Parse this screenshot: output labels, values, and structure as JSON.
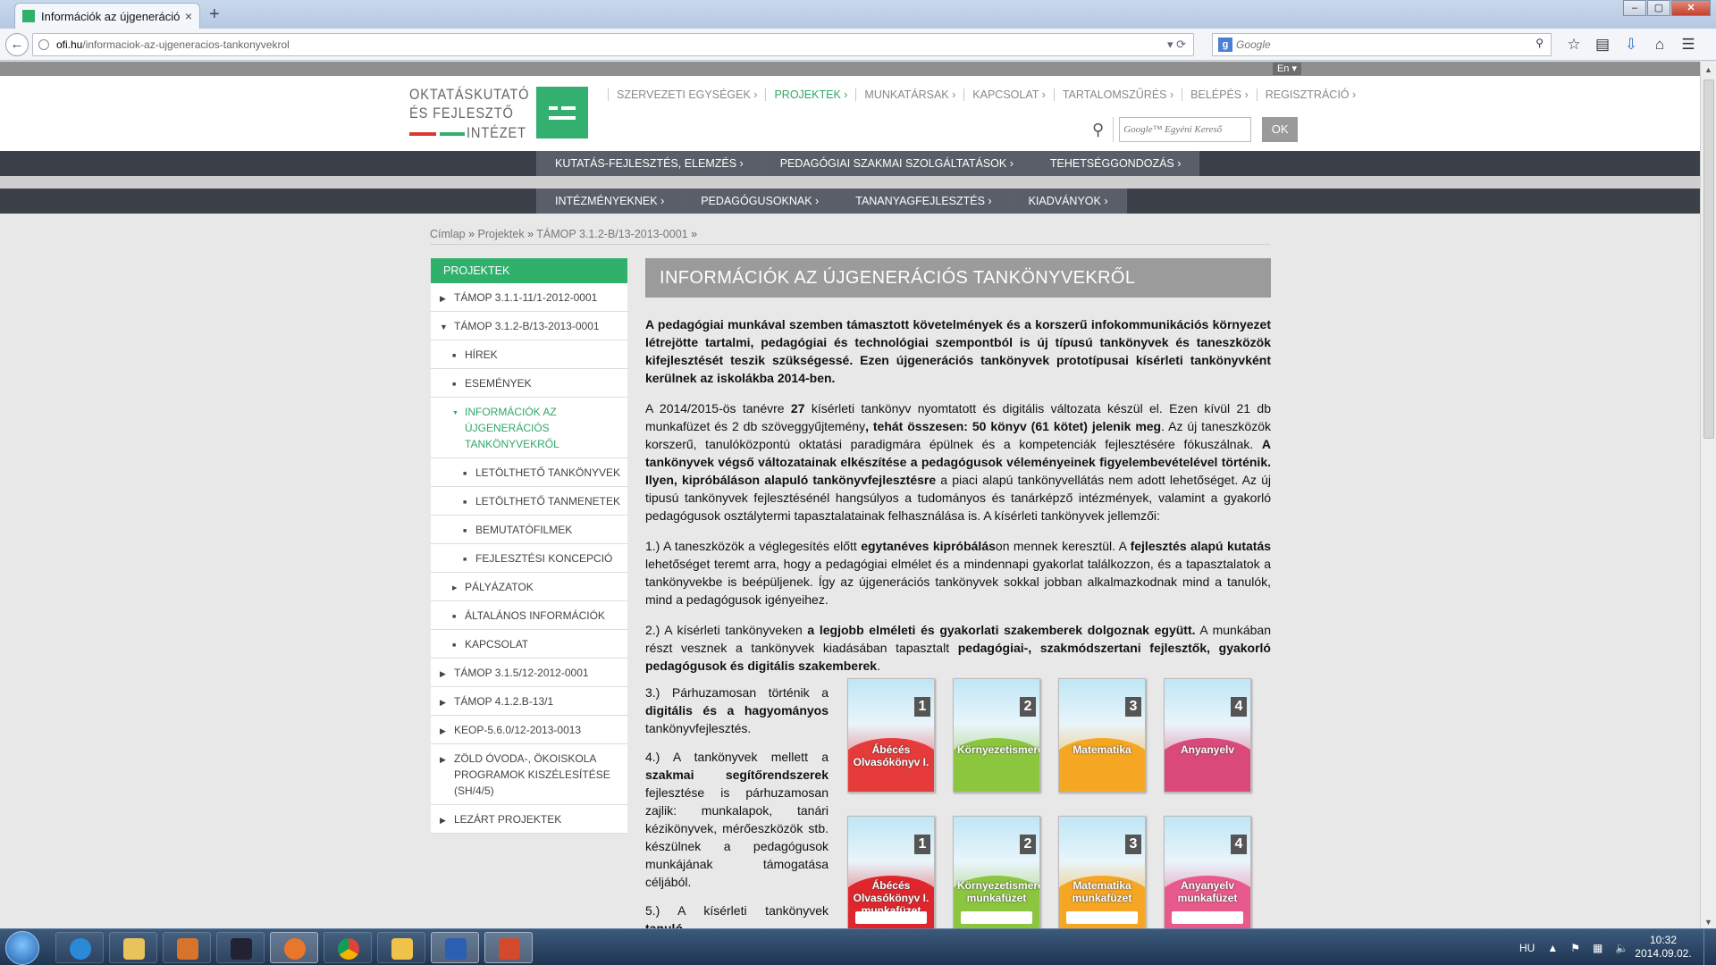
{
  "browser": {
    "tab_title": "Információk az újgeneráció...",
    "tab_close": "×",
    "new_tab": "+",
    "url_host": "ofi.hu",
    "url_path": "/informaciok-az-ujgeneracios-tankonyvekrol",
    "search_placeholder": "Google",
    "window_controls": [
      "–",
      "▢",
      "✕"
    ]
  },
  "site": {
    "lang": "En ▾",
    "logo": {
      "line1": "OKTATÁSKUTATÓ",
      "line2": "ÉS FEJLESZTŐ",
      "line3": "INTÉZET"
    },
    "top_menu": [
      {
        "label": "SZERVEZETI EGYSÉGEK ›",
        "active": false
      },
      {
        "label": "PROJEKTEK ›",
        "active": true
      },
      {
        "label": "MUNKATÁRSAK ›",
        "active": false
      },
      {
        "label": "KAPCSOLAT ›",
        "active": false
      },
      {
        "label": "TARTALOMSZŰRÉS ›",
        "active": false
      },
      {
        "label": "BELÉPÉS ›",
        "active": false
      },
      {
        "label": "REGISZTRÁCIÓ ›",
        "active": false
      }
    ],
    "search": {
      "placeholder": "Google™ Egyéni Kereső",
      "button": "OK"
    },
    "main_menu_1": [
      "KUTATÁS-FEJLESZTÉS, ELEMZÉS ›",
      "PEDAGÓGIAI SZAKMAI SZOLGÁLTATÁSOK ›",
      "TEHETSÉGGONDOZÁS ›"
    ],
    "main_menu_2": [
      "INTÉZMÉNYEKNEK ›",
      "PEDAGÓGUSOKNAK ›",
      "TANANYAGFEJLESZTÉS ›",
      "KIADVÁNYOK ›"
    ],
    "breadcrumb": [
      "Címlap",
      "Projektek",
      "TÁMOP 3.1.2-B/13-2013-0001"
    ],
    "breadcrumb_sep": " » "
  },
  "sidebar": {
    "title": "PROJEKTEK",
    "items": [
      {
        "label": "TÁMOP 3.1.1-11/1-2012-0001",
        "level": 1,
        "marker": "▶"
      },
      {
        "label": "TÁMOP 3.1.2-B/13-2013-0001",
        "level": 1,
        "marker": "▼"
      },
      {
        "label": "HÍREK",
        "level": 2,
        "marker": "■"
      },
      {
        "label": "ESEMÉNYEK",
        "level": 2,
        "marker": "■"
      },
      {
        "label": "INFORMÁCIÓK AZ ÚJGENERÁCIÓS TANKÖNYVEKRŐL",
        "level": 2,
        "marker": "▼",
        "active": true
      },
      {
        "label": "LETÖLTHETŐ TANKÖNYVEK",
        "level": 3,
        "marker": "■"
      },
      {
        "label": "LETÖLTHETŐ TANMENETEK",
        "level": 3,
        "marker": "■"
      },
      {
        "label": "BEMUTATÓFILMEK",
        "level": 3,
        "marker": "■"
      },
      {
        "label": "FEJLESZTÉSI KONCEPCIÓ",
        "level": 3,
        "marker": "■"
      },
      {
        "label": "PÁLYÁZATOK",
        "level": 2,
        "marker": "▶"
      },
      {
        "label": "ÁLTALÁNOS INFORMÁCIÓK",
        "level": 2,
        "marker": "■"
      },
      {
        "label": "KAPCSOLAT",
        "level": 2,
        "marker": "■"
      },
      {
        "label": "TÁMOP 3.1.5/12-2012-0001",
        "level": 1,
        "marker": "▶"
      },
      {
        "label": "TÁMOP 4.1.2.B-13/1",
        "level": 1,
        "marker": "▶"
      },
      {
        "label": "KEOP-5.6.0/12-2013-0013",
        "level": 1,
        "marker": "▶"
      },
      {
        "label": "ZÖLD ÓVODA-, ÖKOISKOLA PROGRAMOK KISZÉLESÍTÉSE (SH/4/5)",
        "level": 1,
        "marker": "▶"
      },
      {
        "label": "LEZÁRT PROJEKTEK",
        "level": 1,
        "marker": "▶"
      }
    ]
  },
  "content": {
    "title": "INFORMÁCIÓK AZ ÚJGENERÁCIÓS TANKÖNYVEKRŐL",
    "intro": "A pedagógiai munkával szemben támasztott követelmények és a korszerű infokommunikációs környezet létrejötte tartalmi, pedagógiai és technológiai szempontból is új típusú tankönyvek és taneszközök kifejlesztését teszik szükségessé. Ezen újgenerációs tankönyvek prototípusai kísérleti tankönyvként kerülnek az iskolákba 2014-ben.",
    "p2": [
      {
        "t": "A 2014/2015-ös tanévre ",
        "b": false
      },
      {
        "t": "27",
        "b": true
      },
      {
        "t": " kísérleti tankönyv nyomtatott és digitális változata készül el. Ezen kívül 21 db munkafüzet és 2 db szöveggyűjtemény",
        "b": false
      },
      {
        "t": ", tehát összesen: 50 könyv (61 kötet) jelenik meg",
        "b": true
      },
      {
        "t": ". Az új taneszközök korszerű, tanulóközpontú oktatási paradigmára épülnek és a kompetenciák fejlesztésére fókuszálnak. ",
        "b": false
      },
      {
        "t": "A tankönyvek végső változatainak elkészítése a pedagógusok véleményeinek figyelembevételével történik. Ilyen, kipróbáláson alapuló tankönyvfejlesztésre",
        "b": true
      },
      {
        "t": " a piaci alapú tankönyvellátás nem adott lehetőséget. Az új tipusú tankönyvek fejlesztésénél hangsúlyos a tudományos és tanárképző intézmények, valamint a gyakorló pedagógusok osztálytermi tapasztalatainak felhasználása is. A kísérleti tankönyvek jellemzői:",
        "b": false
      }
    ],
    "p3": [
      {
        "t": "1.) A taneszközök a véglegesítés előtt ",
        "b": false
      },
      {
        "t": "egytanéves kipróbálás",
        "b": true
      },
      {
        "t": "on mennek keresztül. A ",
        "b": false
      },
      {
        "t": "fejlesztés alapú kutatás",
        "b": true
      },
      {
        "t": " lehetőséget teremt arra, hogy a pedagógiai elmélet és a mindennapi gyakorlat találkozzon, és a tapasztalatok a tankönyvekbe is beépüljenek. Így az újgenerációs tankönyvek sokkal jobban alkalmazkodnak mind a tanulók, mind a pedagógusok igényeihez.",
        "b": false
      }
    ],
    "p4": [
      {
        "t": "2.) A kísérleti tankönyveken ",
        "b": false
      },
      {
        "t": "a legjobb elméleti és gyakorlati szakemberek dolgoznak együtt.",
        "b": true
      },
      {
        "t": " A munkában részt vesznek a tankönyvek kiadásában tapasztalt ",
        "b": false
      },
      {
        "t": "pedagógiai-, szakmódszertani fejlesztők, gyakorló pedagógusok és digitális szakemberek",
        "b": true
      },
      {
        "t": ".",
        "b": false
      }
    ],
    "p5": [
      {
        "t": "3.) Párhuzamosan történik a ",
        "b": false
      },
      {
        "t": "digitális és a hagyományos",
        "b": true
      },
      {
        "t": " tankönyvfejlesztés.",
        "b": false
      }
    ],
    "p6": [
      {
        "t": "4.) A tankönyvek mellett a ",
        "b": false
      },
      {
        "t": "szakmai segítőrendszerek",
        "b": true
      },
      {
        "t": " fejlesztése is párhuzamosan zajlik: munkalapok, tanári kézikönyvek, mérőeszközök stb. készülnek a pedagógusok munkájának támogatása céljából.",
        "b": false
      }
    ],
    "p7": [
      {
        "t": "5.) A kísérleti tankönyvek ",
        "b": false
      },
      {
        "t": "tanuló-",
        "b": true
      }
    ],
    "books": [
      {
        "title": "Ábécés Olvasókönyv I.",
        "num": "1",
        "color": "#e53b3b"
      },
      {
        "title": "Környezetismeret",
        "num": "2",
        "color": "#8cc63f"
      },
      {
        "title": "Matematika",
        "num": "3",
        "color": "#f5a623"
      },
      {
        "title": "Anyanyelv",
        "num": "4",
        "color": "#d94a7a"
      },
      {
        "title": "Ábécés Olvasókönyv I. munkafüzet",
        "num": "1",
        "color": "#e0262d"
      },
      {
        "title": "Környezetismeret munkafüzet",
        "num": "2",
        "color": "#8cc63f"
      },
      {
        "title": "Matematika munkafüzet",
        "num": "3",
        "color": "#f5a623"
      },
      {
        "title": "Anyanyelv munkafüzet",
        "num": "4",
        "color": "#e85a8c"
      }
    ]
  },
  "taskbar": {
    "lang": "HU",
    "time": "10:32",
    "date": "2014.09.02."
  }
}
